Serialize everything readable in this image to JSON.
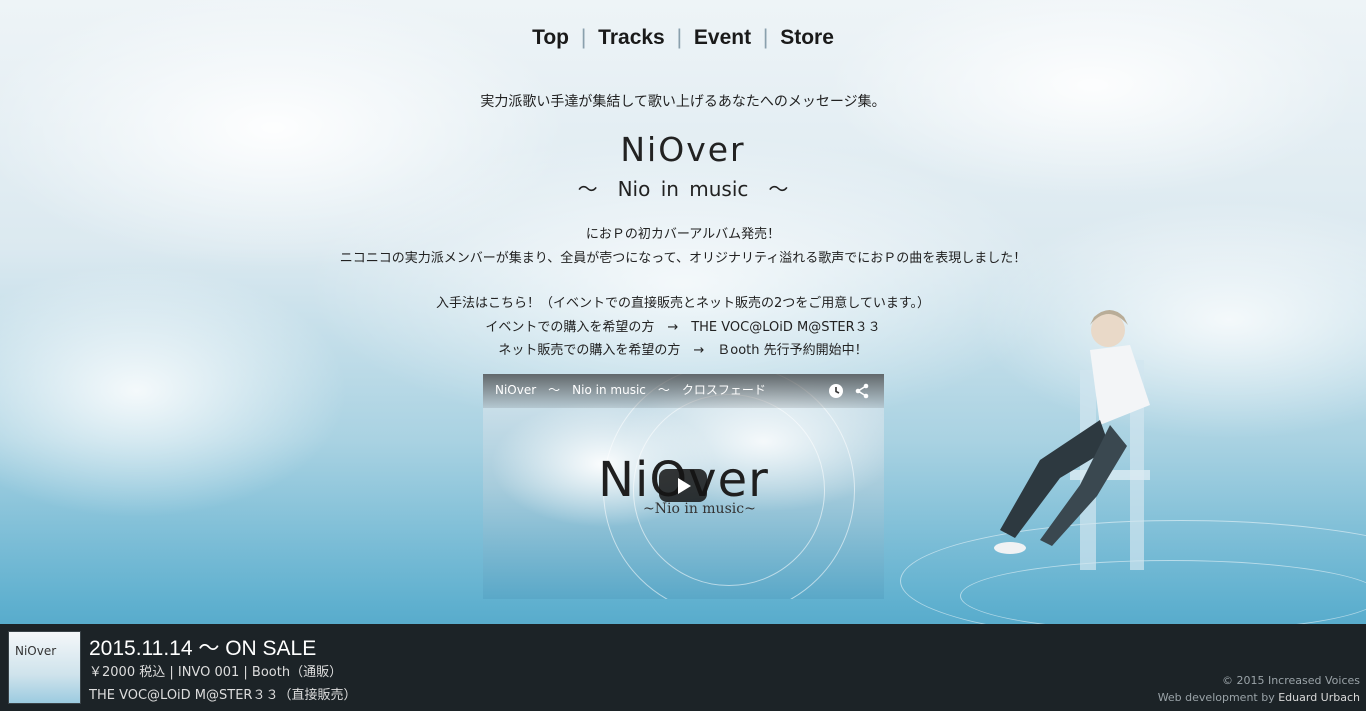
{
  "nav": {
    "items": [
      {
        "label": "Top"
      },
      {
        "label": "Tracks"
      },
      {
        "label": "Event"
      },
      {
        "label": "Store"
      }
    ],
    "separator": "|"
  },
  "hero": {
    "tagline": "実力派歌い手達が集結して歌い上げるあなたへのメッセージ集。",
    "title": "NiOver",
    "subtitle": "～　Nio in music　～"
  },
  "description": {
    "line1": "におＰの初カバーアルバム発売！",
    "line2": "ニコニコの実力派メンバーが集まり、全員が壱つになって、オリジナリティ溢れる歌声でにおＰの曲を表現しました！",
    "line3": "入手法はこちら！（イベントでの直接販売とネット販売の2つをご用意しています。）",
    "line4": "イベントでの購入を希望の方　→　THE VOC@LOiD M@STER３３",
    "line5": "ネット販売での購入を希望の方　→　Ｂooth 先行予約開始中！"
  },
  "video": {
    "title": "NiOver　～　Nio in music　～　クロスフェード",
    "logo": "NiOver",
    "logo_sub": "~Nio in music~",
    "icons": [
      "clock-icon",
      "share-icon",
      "play-icon"
    ]
  },
  "footer": {
    "cover_title": "NiOver",
    "release": "2015.11.14 ～ ON SALE",
    "info1": "￥2000 税込 | INVO 001 | Booth（通販）",
    "info2": "THE VOC@LOiD M@STER３３（直接販売）",
    "copyright": "© 2015 Increased Voices",
    "dev_prefix": "Web development by",
    "dev_name": "Eduard Urbach"
  }
}
